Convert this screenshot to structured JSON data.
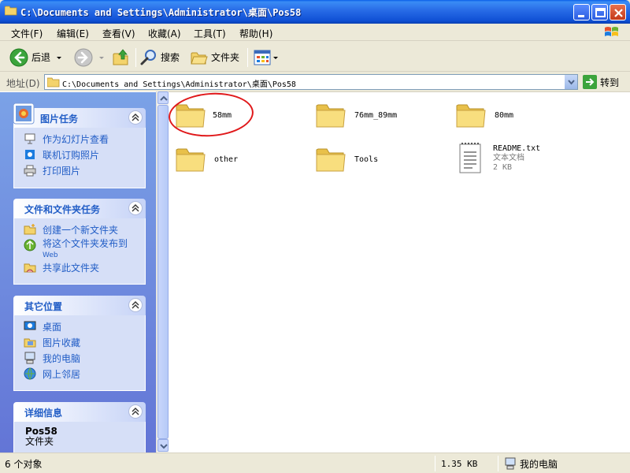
{
  "window": {
    "title": "C:\\Documents and Settings\\Administrator\\桌面\\Pos58"
  },
  "menu": {
    "items": [
      {
        "label": "文件(F)"
      },
      {
        "label": "编辑(E)"
      },
      {
        "label": "查看(V)"
      },
      {
        "label": "收藏(A)"
      },
      {
        "label": "工具(T)"
      },
      {
        "label": "帮助(H)"
      }
    ]
  },
  "toolbar": {
    "back_label": "后退",
    "search_label": "搜索",
    "folders_label": "文件夹"
  },
  "address": {
    "label": "地址(D)",
    "value": "C:\\Documents and Settings\\Administrator\\桌面\\Pos58",
    "go_label": "转到"
  },
  "sidebar": {
    "picture_tasks": {
      "title": "图片任务",
      "items": [
        "作为幻灯片查看",
        "联机订购照片",
        "打印图片"
      ]
    },
    "file_tasks": {
      "title": "文件和文件夹任务",
      "items": [
        "创建一个新文件夹",
        "将这个文件夹发布到",
        "Web",
        "共享此文件夹"
      ]
    },
    "other_places": {
      "title": "其它位置",
      "items": [
        "桌面",
        "图片收藏",
        "我的电脑",
        "网上邻居"
      ]
    },
    "details": {
      "title": "详细信息",
      "name": "Pos58",
      "type": "文件夹"
    }
  },
  "files": [
    {
      "name": "58mm",
      "kind": "folder"
    },
    {
      "name": "76mm_89mm",
      "kind": "folder"
    },
    {
      "name": "80mm",
      "kind": "folder"
    },
    {
      "name": "other",
      "kind": "folder"
    },
    {
      "name": "Tools",
      "kind": "folder"
    },
    {
      "name": "README.txt",
      "kind": "text",
      "type": "文本文档",
      "size": "2 KB"
    }
  ],
  "status": {
    "objects": "6 个对象",
    "size": "1.35 KB",
    "location": "我的电脑"
  }
}
